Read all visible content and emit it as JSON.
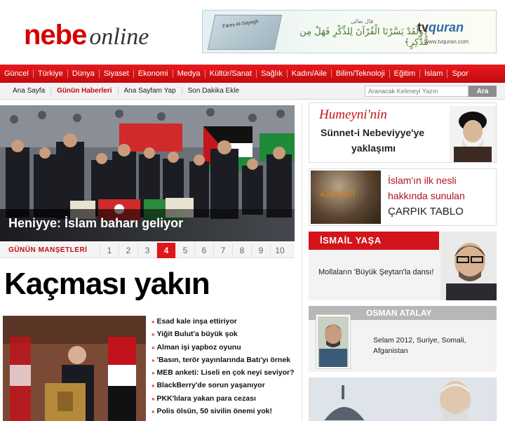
{
  "brand": {
    "logo_main": "nebe",
    "logo_suffix": "online"
  },
  "banner": {
    "arabic_top": "قال تعالى",
    "arabic_verse": "﴿وَلَقَدْ يَسَّرْنَا الْقُرْآنَ لِلذِّكْرِ فَهَلْ مِن مُّدَّكِرٍ﴾",
    "brand_tv": "tv",
    "brand_quran": "quran",
    "url": "www.tvquran.com",
    "book_text": "Fares Al-Sayegh"
  },
  "main_nav": [
    "Güncel",
    "Türkiye",
    "Dünya",
    "Siyaset",
    "Ekonomi",
    "Medya",
    "Kültür/Sanat",
    "Sağlık",
    "Kadın/Aile",
    "Bilim/Teknoloji",
    "Eğitim",
    "İslam",
    "Spor"
  ],
  "sub_nav": [
    "Ana Sayfa",
    "Günün Haberleri",
    "Ana Sayfam Yap",
    "Son Dakika Ekle"
  ],
  "sub_nav_active_index": 1,
  "search": {
    "placeholder": "Aranacak Kelimeyi Yazın",
    "button": "Ara"
  },
  "hero": {
    "caption": "Heniyye: İslam baharı geliyor"
  },
  "pager": {
    "label": "GÜNÜN MANŞETLERİ",
    "pages": [
      "1",
      "2",
      "3",
      "4",
      "5",
      "6",
      "7",
      "8",
      "9",
      "10"
    ],
    "active": "4"
  },
  "headline": "Kaçması yakın",
  "news": [
    "Esad kale inşa ettiriyor",
    "Yiğit Bulut'a büyük şok",
    "Alman işi yapboz oyunu",
    "'Basın, terör yayınlarında Batı'yı örnek",
    "MEB anketi: Liseli en çok neyi seviyor?",
    "BlackBerry'de sorun yaşanıyor",
    "PKK'lılara yakan para cezası",
    "Polis ölsün, 50 sivilin önemi yok!"
  ],
  "ad1": {
    "line1": "Humeyni'nin",
    "line2": "Sünnet-i Nebeviyye'ye",
    "line3": "yaklaşımı"
  },
  "ad2": {
    "arabic": "الصحابة",
    "line1": "İslam'ın ilk nesli",
    "line2": "hakkında sunulan",
    "line3": "ÇARPIK TABLO"
  },
  "columnist1": {
    "name": "İSMAİL YAŞA",
    "title": "Mollaların 'Büyük Şeytan'la dansı!"
  },
  "columnist2": {
    "name": "OSMAN ATALAY",
    "title": "Selam 2012, Suriye, Somali, Afganistan"
  },
  "colors": {
    "accent": "#d40000",
    "nav": "#c20b0e",
    "gray_bar": "#b7b7b7"
  }
}
